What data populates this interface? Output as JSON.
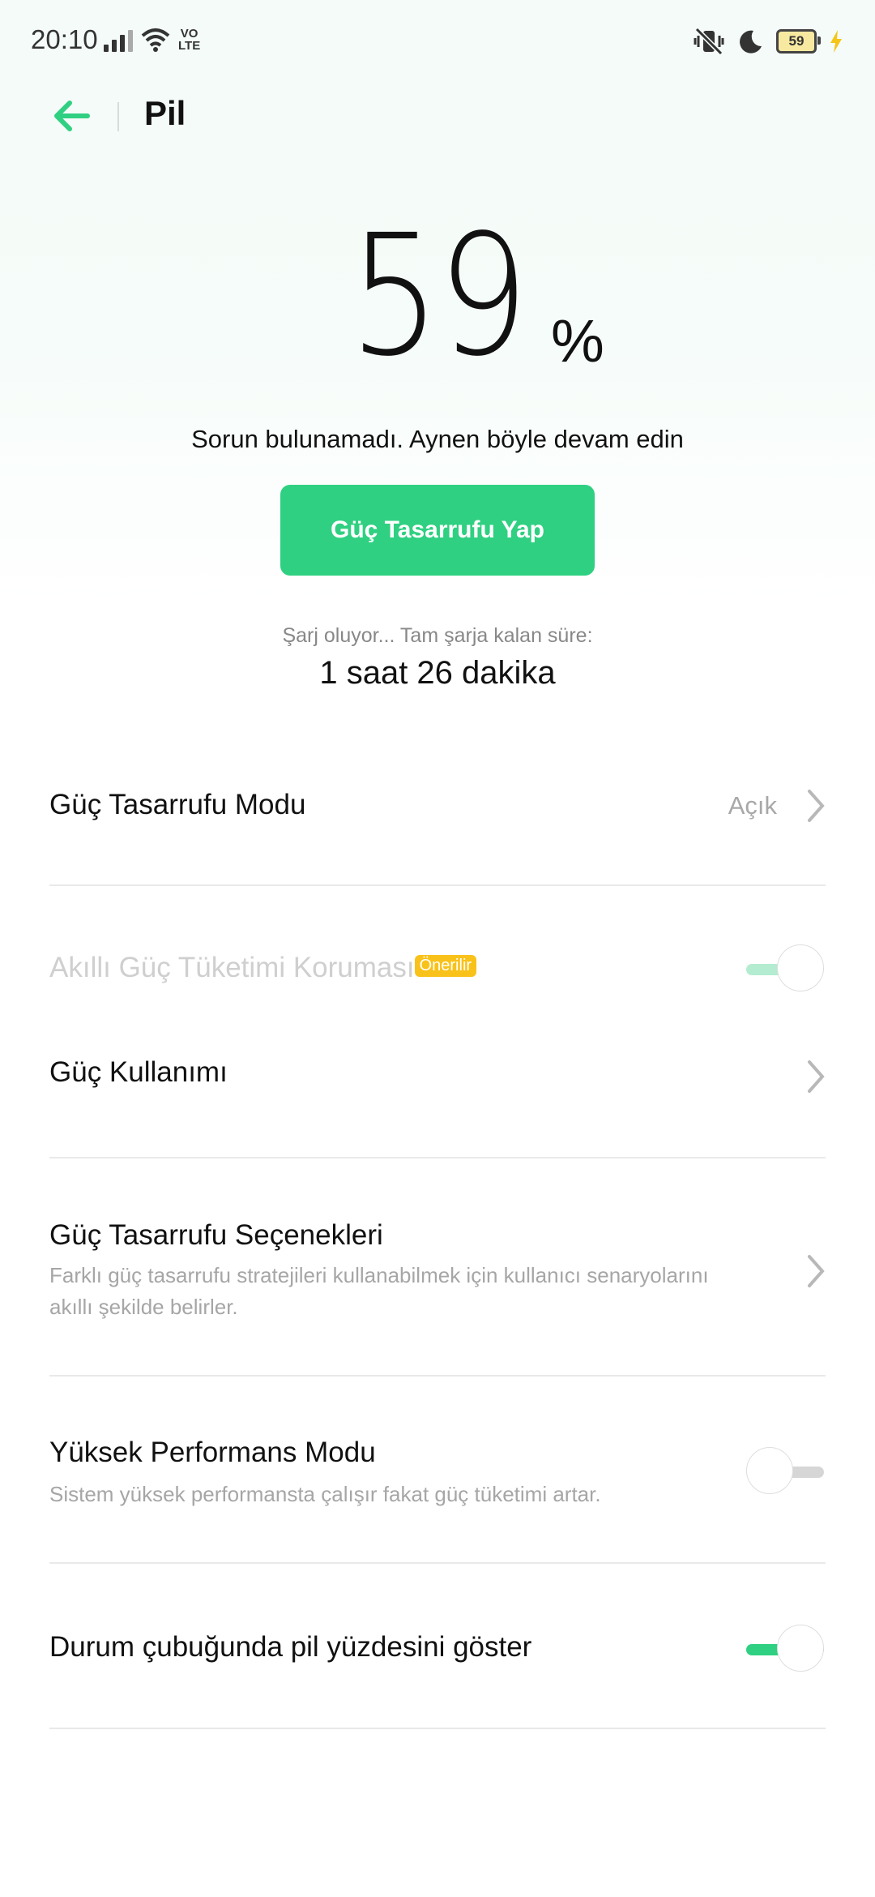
{
  "status_bar": {
    "time": "20:10",
    "network_label": "VO LTE",
    "battery_level": "59",
    "icons": [
      "signal-icon",
      "wifi-icon",
      "volte-icon",
      "mute-vibrate-icon",
      "moon-icon",
      "battery-icon",
      "charging-icon"
    ]
  },
  "header": {
    "title": "Pil",
    "accent_color": "#2fd081"
  },
  "battery": {
    "percent": "59",
    "percent_sign": "%",
    "status_message": "Sorun bulunamadı. Aynen böyle devam edin",
    "save_button_label": "Güç Tasarrufu Yap",
    "charging_label": "Şarj oluyor... Tam şarja kalan süre:",
    "charging_time": "1 saat 26 dakika"
  },
  "settings": {
    "power_saving_mode": {
      "label": "Güç Tasarrufu Modu",
      "value": "Açık"
    },
    "smart_protection": {
      "label": "Akıllı Güç Tüketimi Koruması",
      "badge": "Önerilir",
      "enabled": true,
      "disabled_look": true
    },
    "power_usage": {
      "label": "Güç Kullanımı"
    },
    "power_saving_options": {
      "label": "Güç Tasarrufu Seçenekleri",
      "description_line1": "Farklı güç tasarrufu stratejileri kullanabilmek için kullanıcı senaryolarını",
      "description_line2": "akıllı şekilde belirler."
    },
    "high_performance": {
      "label": "Yüksek Performans Modu",
      "description": "Sistem yüksek performansta çalışır fakat güç tüketimi artar.",
      "enabled": false
    },
    "show_percentage": {
      "label": "Durum çubuğunda pil yüzdesini göster",
      "enabled": true
    }
  }
}
